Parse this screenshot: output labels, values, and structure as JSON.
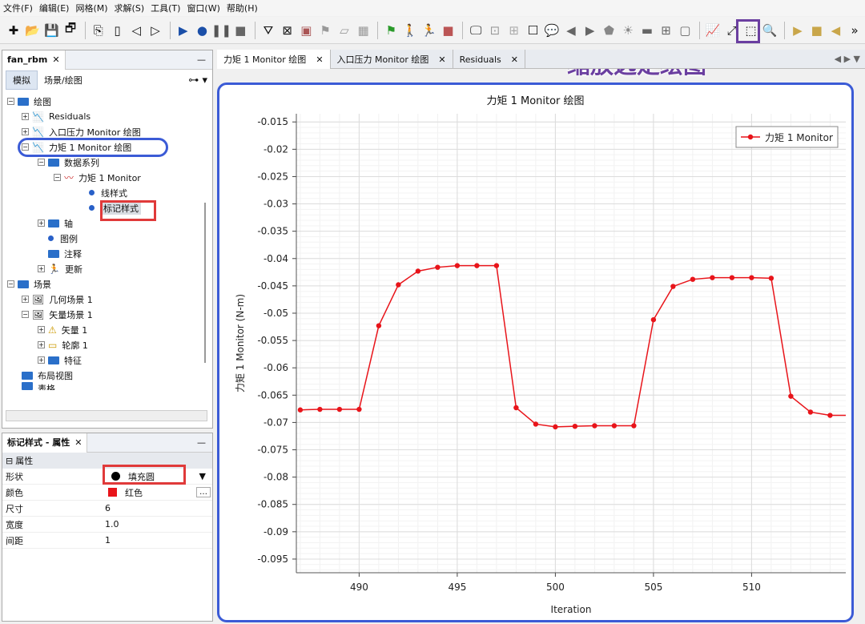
{
  "menu": [
    "文件(F)",
    "编辑(E)",
    "网格(M)",
    "求解(S)",
    "工具(T)",
    "窗口(W)",
    "帮助(H)"
  ],
  "annotation": "缩放选定绘图",
  "left_panel": {
    "tab": "fan_rbm",
    "subtabs": [
      "模拟",
      "场景/绘图"
    ],
    "tree": [
      {
        "label": "绘图"
      },
      {
        "label": "Residuals"
      },
      {
        "label": "入口压力 Monitor 绘图"
      },
      {
        "label": "力矩 1 Monitor 绘图"
      },
      {
        "label": "数据系列"
      },
      {
        "label": "力矩 1 Monitor"
      },
      {
        "label": "线样式"
      },
      {
        "label": "标记样式"
      },
      {
        "label": "轴"
      },
      {
        "label": "图例"
      },
      {
        "label": "注释"
      },
      {
        "label": "更新"
      },
      {
        "label": "场景"
      },
      {
        "label": "几何场景 1"
      },
      {
        "label": "矢量场景 1"
      },
      {
        "label": "矢量 1"
      },
      {
        "label": "轮廓 1"
      },
      {
        "label": "特征"
      },
      {
        "label": "布局视图"
      },
      {
        "label": "表格"
      }
    ]
  },
  "props": {
    "tab": "标记样式 - 属性",
    "section": "属性",
    "rows": [
      {
        "key": "形状",
        "value": "填充圆"
      },
      {
        "key": "颜色",
        "value": "红色"
      },
      {
        "key": "尺寸",
        "value": "6"
      },
      {
        "key": "宽度",
        "value": "1.0"
      },
      {
        "key": "间距",
        "value": "1"
      }
    ]
  },
  "editor_tabs": [
    "力矩 1 Monitor 绘图",
    "入口压力 Monitor 绘图",
    "Residuals"
  ],
  "colors": {
    "series": "#e8141a",
    "highlight_purple": "#6b3fa0",
    "highlight_blue": "#3b5bd6",
    "highlight_red": "#e03a3a"
  },
  "chart_data": {
    "type": "line",
    "title": "力矩 1 Monitor 绘图",
    "xlabel": "Iteration",
    "ylabel": "力矩 1 Monitor (N-m)",
    "xlim": [
      486.8,
      514.8
    ],
    "ylim": [
      -0.0975,
      -0.0135
    ],
    "xticks": [
      490,
      495,
      500,
      505,
      510
    ],
    "yticks": [
      -0.015,
      -0.02,
      -0.025,
      -0.03,
      -0.035,
      -0.04,
      -0.045,
      -0.05,
      -0.055,
      -0.06,
      -0.065,
      -0.07,
      -0.075,
      -0.08,
      -0.085,
      -0.09,
      -0.095
    ],
    "grid": true,
    "legend": "top-right",
    "series": [
      {
        "name": "力矩 1 Monitor",
        "x": [
          487,
          488,
          489,
          490,
          491,
          492,
          493,
          494,
          495,
          496,
          497,
          498,
          499,
          500,
          501,
          502,
          503,
          504,
          505,
          506,
          507,
          508,
          509,
          510,
          511,
          512,
          513,
          514,
          514.8
        ],
        "y": [
          -0.0677,
          -0.0676,
          -0.0676,
          -0.0676,
          -0.0523,
          -0.0448,
          -0.0423,
          -0.0416,
          -0.0413,
          -0.0413,
          -0.0413,
          -0.0673,
          -0.0703,
          -0.0708,
          -0.0707,
          -0.0706,
          -0.0706,
          -0.0706,
          -0.0512,
          -0.0451,
          -0.0438,
          -0.0435,
          -0.0435,
          -0.0435,
          -0.0436,
          -0.0652,
          -0.0681,
          -0.0687,
          -0.0687
        ]
      }
    ]
  }
}
